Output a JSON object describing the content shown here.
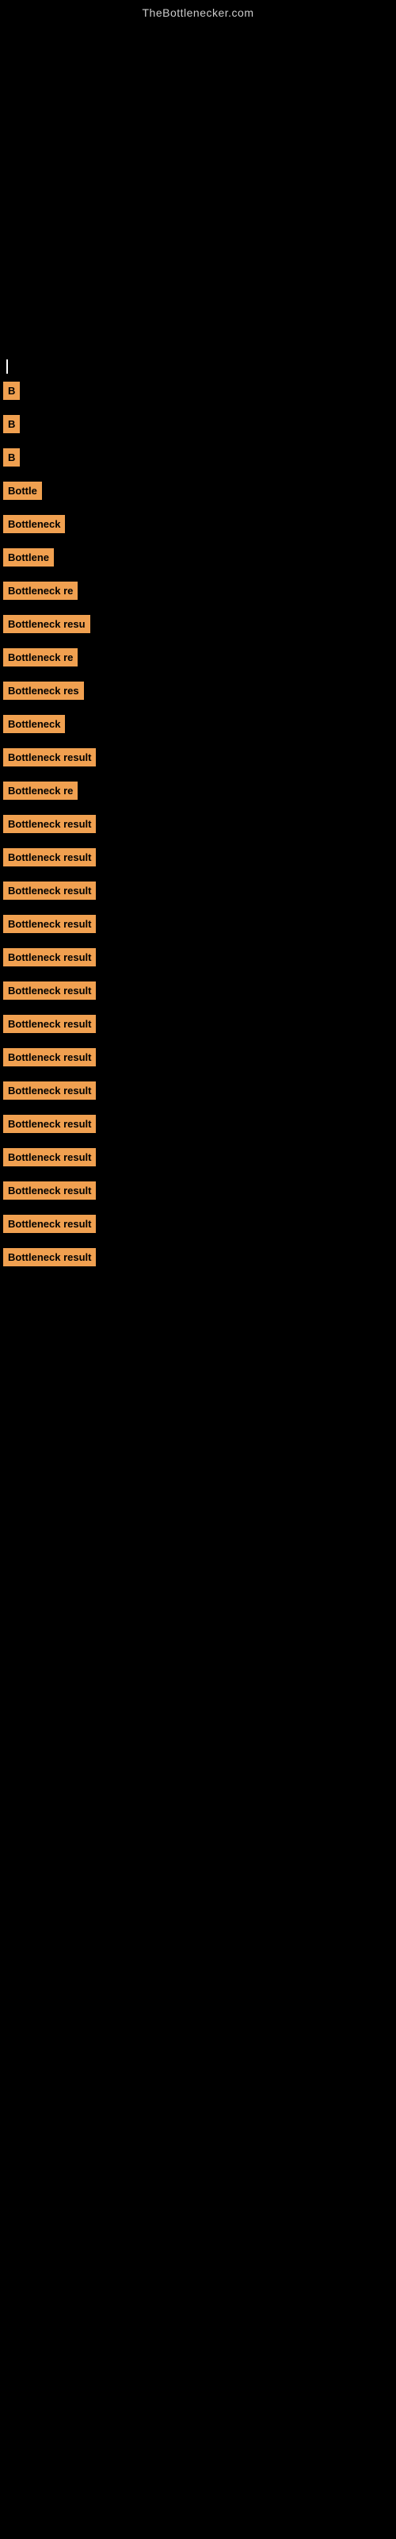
{
  "header": {
    "site_title": "TheBottlenecker.com"
  },
  "items": [
    {
      "label": "B",
      "width": 22
    },
    {
      "label": "B",
      "width": 22
    },
    {
      "label": "B",
      "width": 22
    },
    {
      "label": "Bottle",
      "width": 58
    },
    {
      "label": "Bottleneck",
      "width": 90
    },
    {
      "label": "Bottlene",
      "width": 78
    },
    {
      "label": "Bottleneck re",
      "width": 118
    },
    {
      "label": "Bottleneck resu",
      "width": 135
    },
    {
      "label": "Bottleneck re",
      "width": 118
    },
    {
      "label": "Bottleneck res",
      "width": 126
    },
    {
      "label": "Bottleneck",
      "width": 90
    },
    {
      "label": "Bottleneck result",
      "width": 152
    },
    {
      "label": "Bottleneck re",
      "width": 118
    },
    {
      "label": "Bottleneck result",
      "width": 152
    },
    {
      "label": "Bottleneck result",
      "width": 152
    },
    {
      "label": "Bottleneck result",
      "width": 152
    },
    {
      "label": "Bottleneck result",
      "width": 152
    },
    {
      "label": "Bottleneck result",
      "width": 152
    },
    {
      "label": "Bottleneck result",
      "width": 152
    },
    {
      "label": "Bottleneck result",
      "width": 152
    },
    {
      "label": "Bottleneck result",
      "width": 152
    },
    {
      "label": "Bottleneck result",
      "width": 152
    },
    {
      "label": "Bottleneck result",
      "width": 152
    },
    {
      "label": "Bottleneck result",
      "width": 152
    },
    {
      "label": "Bottleneck result",
      "width": 152
    },
    {
      "label": "Bottleneck result",
      "width": 152
    },
    {
      "label": "Bottleneck result",
      "width": 152
    }
  ]
}
